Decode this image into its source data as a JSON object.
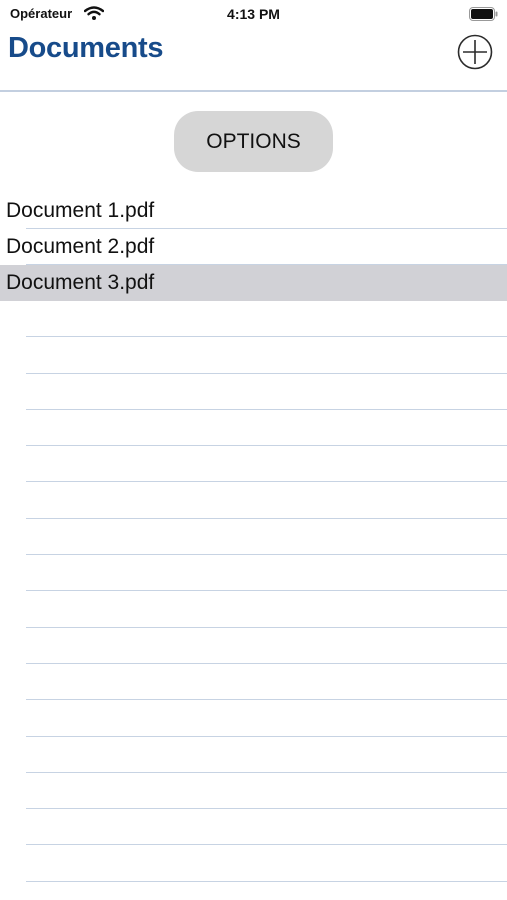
{
  "status_bar": {
    "carrier": "Opérateur",
    "time": "4:13 PM",
    "wifi_icon": "wifi-icon",
    "battery_icon": "battery-icon"
  },
  "nav": {
    "title": "Documents",
    "add_icon": "plus-circle-icon",
    "title_color": "#174b8a"
  },
  "options_button": {
    "label": "OPTIONS"
  },
  "documents": [
    {
      "name": "Document 1.pdf",
      "selected": false
    },
    {
      "name": "Document 2.pdf",
      "selected": false
    },
    {
      "name": "Document 3.pdf",
      "selected": true
    }
  ],
  "colors": {
    "separator": "#c7d3e3",
    "selection": "#d1d1d6",
    "button_bg": "#d6d6d6"
  }
}
